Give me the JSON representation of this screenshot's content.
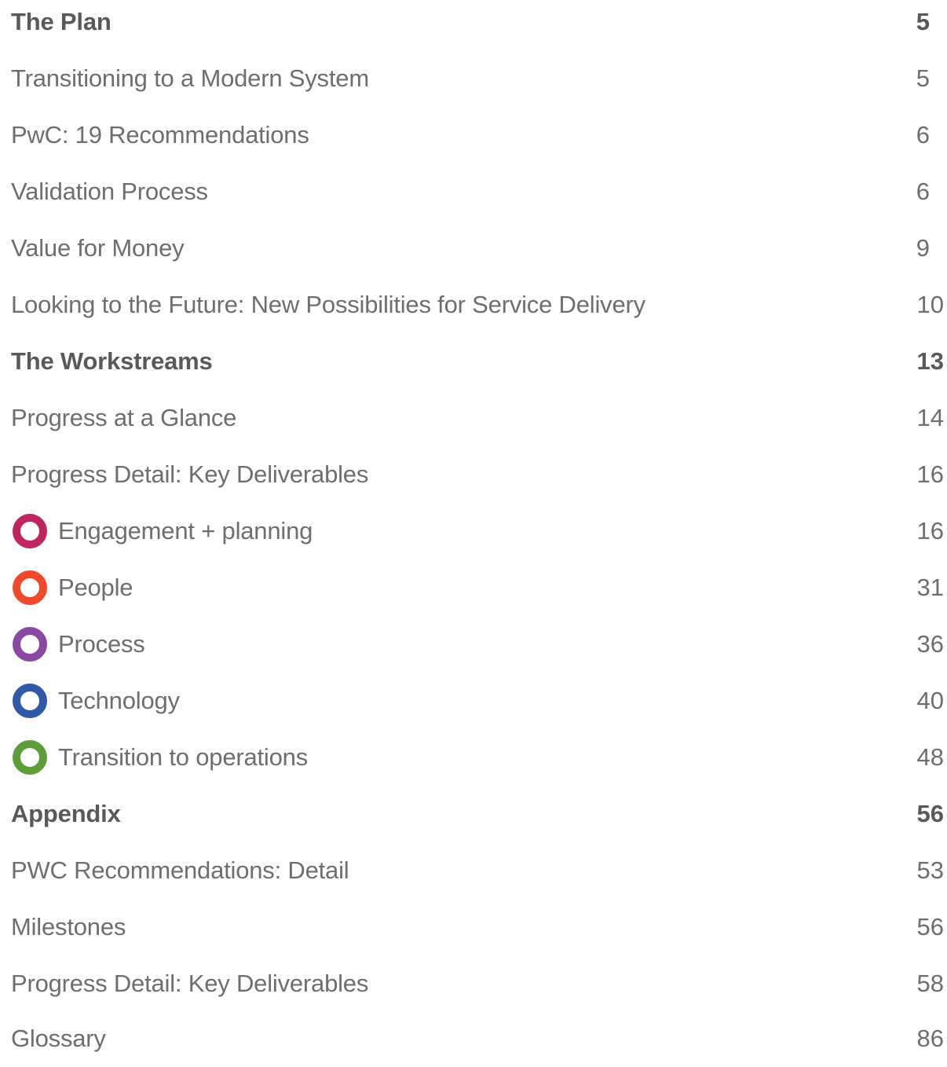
{
  "toc": {
    "plan": {
      "heading": {
        "title": "The Plan",
        "page": "5"
      },
      "entries": [
        {
          "title": "Transitioning to a Modern System",
          "page": "5"
        },
        {
          "title": "PwC: 19 Recommendations",
          "page": "6"
        },
        {
          "title": "Validation Process",
          "page": "6"
        },
        {
          "title": "Value for Money",
          "page": "9"
        },
        {
          "title": "Looking to the Future: New Possibilities for Service Delivery",
          "page": "10"
        }
      ]
    },
    "workstreams": {
      "heading": {
        "title": "The Workstreams",
        "page": "13"
      },
      "entries": [
        {
          "title": "Progress at a Glance",
          "page": "14"
        },
        {
          "title": "Progress Detail: Key Deliverables",
          "page": "16"
        }
      ],
      "streams": [
        {
          "title": "Engagement + planning",
          "page": "16",
          "color": "#c0255f",
          "icon": "ring-icon"
        },
        {
          "title": "People",
          "page": "31",
          "color": "#ef4a2b",
          "icon": "ring-icon"
        },
        {
          "title": "Process",
          "page": "36",
          "color": "#8b48a2",
          "icon": "ring-icon"
        },
        {
          "title": "Technology",
          "page": "40",
          "color": "#2e5aa8",
          "icon": "ring-icon"
        },
        {
          "title": "Transition to operations",
          "page": "48",
          "color": "#5e9e3a",
          "icon": "ring-icon"
        }
      ]
    },
    "appendix": {
      "heading": {
        "title": "Appendix",
        "page": "56"
      },
      "entries": [
        {
          "title": "PWC Recommendations: Detail",
          "page": "53"
        },
        {
          "title": "Milestones",
          "page": "56"
        },
        {
          "title": "Progress Detail: Key Deliverables",
          "page": "58"
        },
        {
          "title": "Glossary",
          "page": "86"
        }
      ]
    }
  }
}
